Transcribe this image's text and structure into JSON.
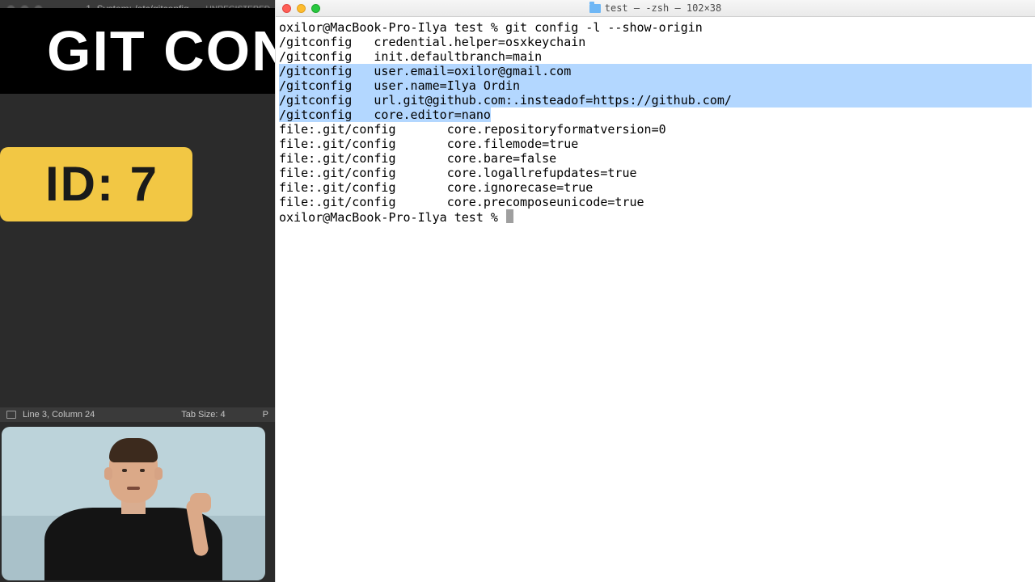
{
  "overlay": {
    "title": "GIT CONFIG",
    "badge": "ID: 7"
  },
  "editor": {
    "titlebar": {
      "title": "1. System: /etc/gitconfig",
      "unregistered": "UNREGISTERED"
    },
    "tab": {
      "label": "1. System: /etc/gitconfig"
    },
    "status": {
      "cursor": "Line 3, Column 24",
      "tabsize": "Tab Size: 4",
      "syntax": "P"
    }
  },
  "terminal": {
    "title": "test — -zsh — 102×38",
    "prompt_user": "oxilor@MacBook-Pro-Ilya",
    "prompt_dir": "test",
    "prompt_symbol": "%",
    "command": "git config -l --show-origin",
    "pad": "   ",
    "lines": [
      {
        "type": "plain",
        "origin": "/gitconfig",
        "value": "credential.helper=osxkeychain"
      },
      {
        "type": "plain",
        "origin": "/gitconfig",
        "value": "init.defaultbranch=main"
      },
      {
        "type": "hl_full",
        "origin": "/gitconfig",
        "value": "user.email=oxilor@gmail.com"
      },
      {
        "type": "hl_full",
        "origin": "/gitconfig",
        "value": "user.name=Ilya Ordin"
      },
      {
        "type": "hl_partial",
        "origin": "/gitconfig",
        "pre": "url.git@github.com:",
        "post": ".insteadof=https://github.com/"
      },
      {
        "type": "hl_end",
        "origin": "/gitconfig",
        "value": "core.editor=nano"
      },
      {
        "type": "plain",
        "origin": "file:.git/config",
        "pad": "       ",
        "value": "core.repositoryformatversion=0"
      },
      {
        "type": "plain",
        "origin": "file:.git/config",
        "pad": "       ",
        "value": "core.filemode=true"
      },
      {
        "type": "plain",
        "origin": "file:.git/config",
        "pad": "       ",
        "value": "core.bare=false"
      },
      {
        "type": "plain",
        "origin": "file:.git/config",
        "pad": "       ",
        "value": "core.logallrefupdates=true"
      },
      {
        "type": "plain",
        "origin": "file:.git/config",
        "pad": "       ",
        "value": "core.ignorecase=true"
      },
      {
        "type": "plain",
        "origin": "file:.git/config",
        "pad": "       ",
        "value": "core.precomposeunicode=true"
      }
    ]
  }
}
